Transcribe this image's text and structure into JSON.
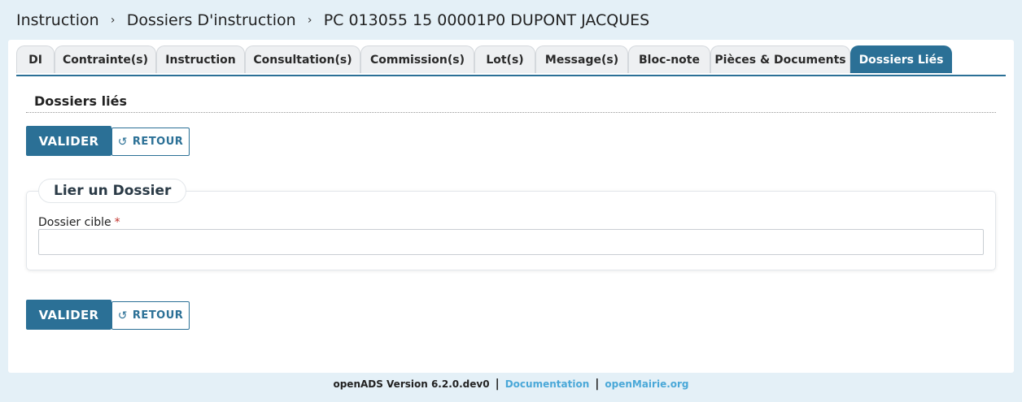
{
  "breadcrumb": {
    "items": [
      "Instruction",
      "Dossiers D'instruction",
      "PC 013055 15 00001P0 DUPONT JACQUES"
    ],
    "separator": "›"
  },
  "tabs": [
    {
      "label": "DI",
      "active": false
    },
    {
      "label": "Contrainte(s)",
      "active": false
    },
    {
      "label": "Instruction",
      "active": false
    },
    {
      "label": "Consultation(s)",
      "active": false
    },
    {
      "label": "Commission(s)",
      "active": false
    },
    {
      "label": "Lot(s)",
      "active": false
    },
    {
      "label": "Message(s)",
      "active": false
    },
    {
      "label": "Bloc-note",
      "active": false
    },
    {
      "label": "Pièces & Documents",
      "active": false
    },
    {
      "label": "Dossiers Liés",
      "active": true
    }
  ],
  "section": {
    "title": "Dossiers liés"
  },
  "actions": {
    "valider_label": "VALIDER",
    "retour_label": "RETOUR",
    "retour_icon": "undo-icon"
  },
  "form": {
    "legend": "Lier un Dossier",
    "field_label": "Dossier cible",
    "required_marker": "*",
    "field_value": ""
  },
  "footer": {
    "version": "openADS Version 6.2.0.dev0",
    "separator": "|",
    "documentation": "Documentation",
    "openmairie": "openMairie.org"
  },
  "colors": {
    "accent": "#2b7096",
    "background": "#e4f0f7",
    "link": "#4aa8d8",
    "required": "#c0302a"
  }
}
